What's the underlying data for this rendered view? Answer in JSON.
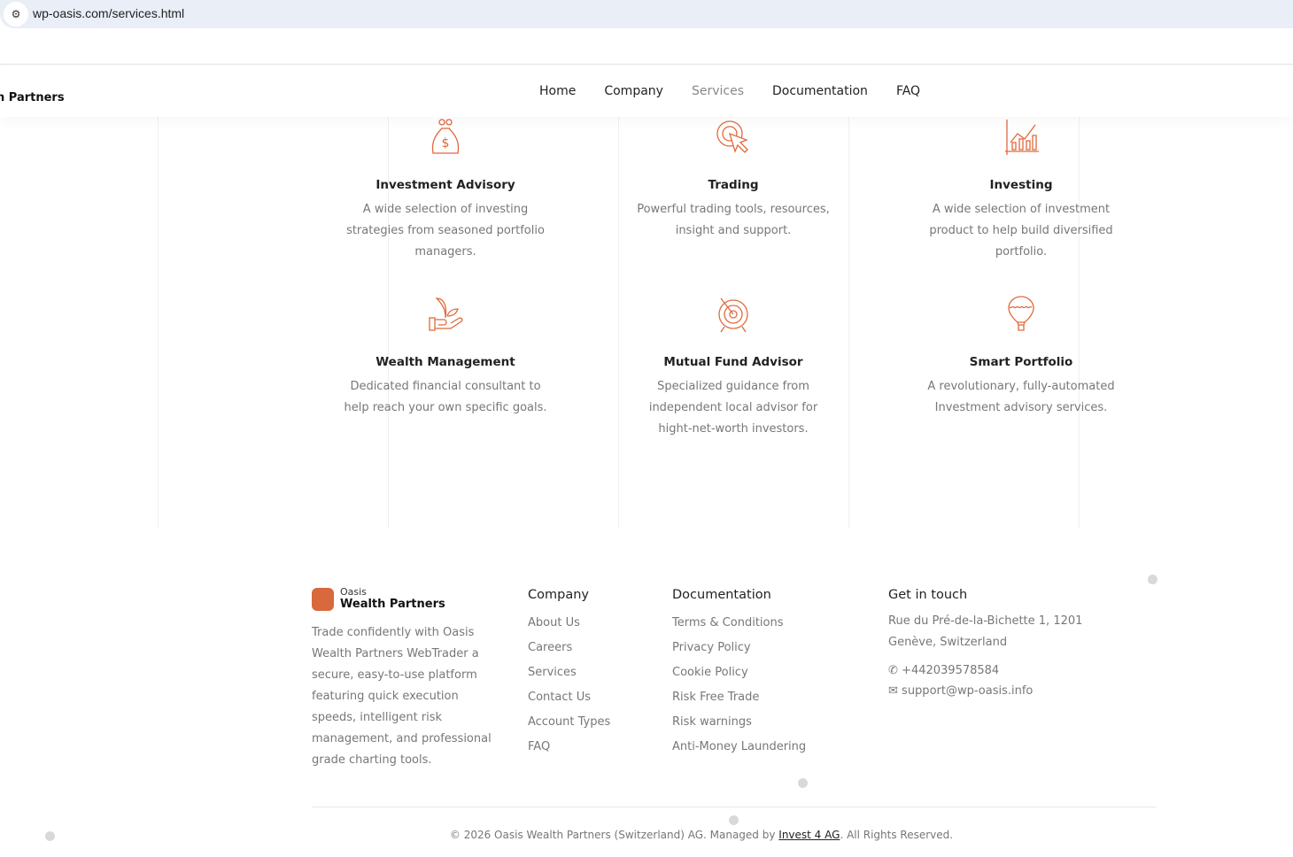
{
  "browser": {
    "url": "wp-oasis.com/services.html"
  },
  "header": {
    "brand": "n Partners",
    "menu": [
      "Home",
      "Company",
      "Services",
      "Documentation",
      "FAQ"
    ]
  },
  "services": [
    {
      "icon": "money-bag-icon",
      "title": "Investment Advisory",
      "desc": "A wide selection of investing strategies from seasoned portfolio managers."
    },
    {
      "icon": "cursor-click-icon",
      "title": "Trading",
      "desc": "Powerful trading tools, resources, insight and support."
    },
    {
      "icon": "bar-chart-icon",
      "title": "Investing",
      "desc": "A wide selection of investment product to help build diversified portfolio."
    },
    {
      "icon": "hand-plant-icon",
      "title": "Wealth Management",
      "desc": "Dedicated financial consultant to help reach your own specific goals."
    },
    {
      "icon": "target-icon",
      "title": "Mutual Fund Advisor",
      "desc": "Specialized guidance from independent local advisor for hight-net-worth investors."
    },
    {
      "icon": "hot-air-balloon-icon",
      "title": "Smart Portfolio",
      "desc": "A revolutionary, fully-automated Investment advisory services."
    }
  ],
  "footer": {
    "logo_small": "Oasis",
    "logo_big": "Wealth Partners",
    "about": "Trade confidently with Oasis Wealth Partners WebTrader a secure, easy-to-use platform featuring quick execution speeds, intelligent risk management, and professional grade charting tools.",
    "company": {
      "heading": "Company",
      "links": [
        "About Us",
        "Careers",
        "Services",
        "Contact Us",
        "Account Types",
        "FAQ"
      ]
    },
    "docs": {
      "heading": "Documentation",
      "links": [
        "Terms & Conditions",
        "Privacy Policy",
        "Cookie Policy",
        "Risk Free Trade",
        "Risk warnings",
        "Anti-Money Laundering"
      ]
    },
    "contact": {
      "heading": "Get in touch",
      "address": "Rue du Pré-de-la-Bichette 1, 1201 Genève, Switzerland",
      "phone": "+442039578584",
      "email": "support@wp-oasis.info"
    },
    "copyright_pre": "© 2026 Oasis Wealth Partners (Switzerland) AG. Managed by ",
    "copyright_link": "Invest 4 AG",
    "copyright_post": ". All Rights Reserved."
  },
  "colors": {
    "accent": "#e2683a"
  }
}
